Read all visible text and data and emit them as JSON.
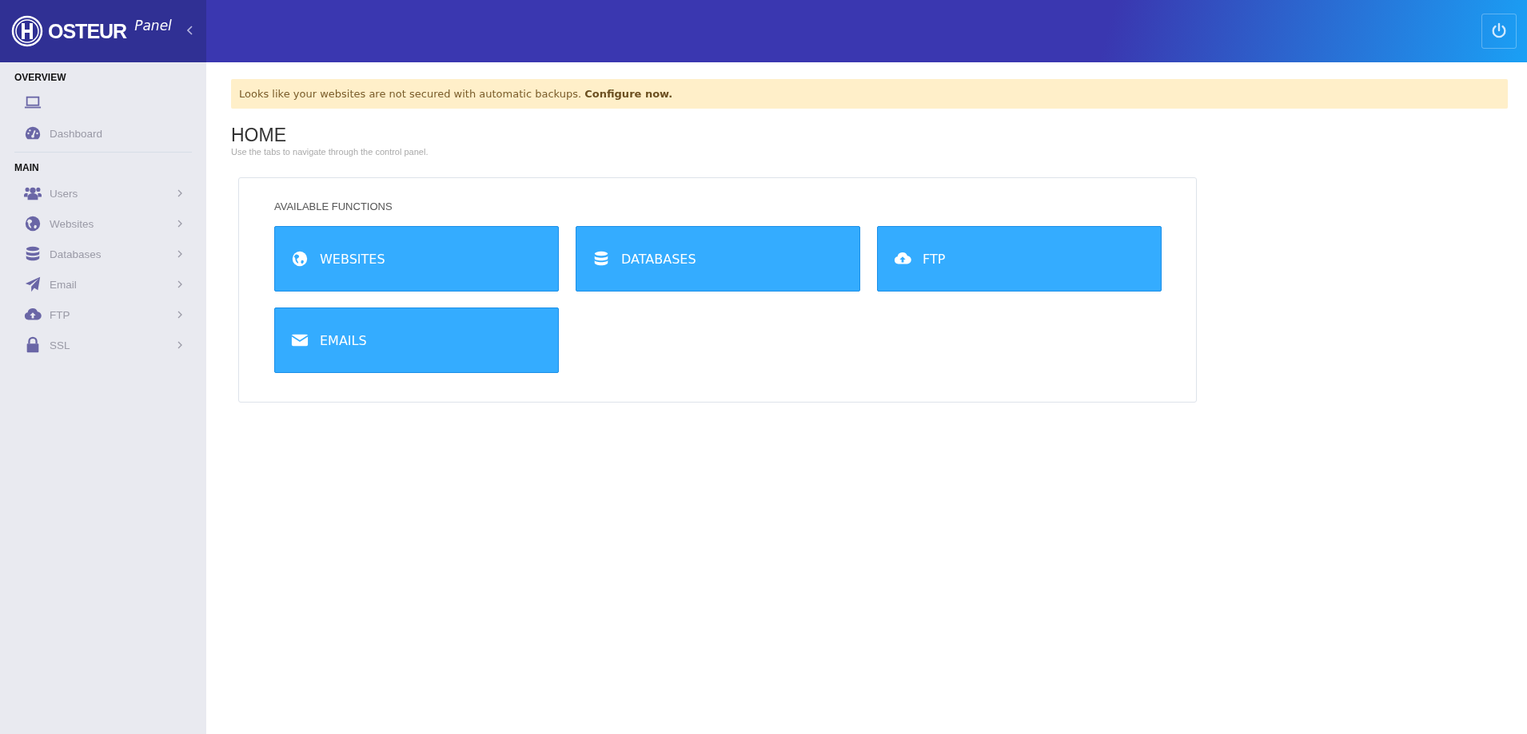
{
  "brand": {
    "logo_text": "OSTEUR",
    "subtitle": "Panel"
  },
  "sidebar": {
    "sections": [
      {
        "title": "OVERVIEW",
        "items": [
          {
            "kind": "laptop",
            "submenu": false
          },
          {
            "kind": "gauge",
            "label": "Dashboard",
            "submenu": false
          }
        ]
      },
      {
        "title": "MAIN",
        "items": [
          {
            "kind": "users",
            "label": "Users",
            "submenu": true
          },
          {
            "kind": "globe",
            "label": "Websites",
            "submenu": true
          },
          {
            "kind": "database",
            "label": "Databases",
            "submenu": true
          },
          {
            "kind": "plane",
            "label": "Email",
            "submenu": true
          },
          {
            "kind": "cloud",
            "label": "FTP",
            "submenu": true
          },
          {
            "kind": "lock",
            "label": "SSL",
            "submenu": true
          }
        ]
      }
    ]
  },
  "alert": {
    "text": "Looks like your websites are not secured with automatic backups. ",
    "link": "Configure now."
  },
  "page": {
    "title": "HOME",
    "subtitle": "Use the tabs to navigate through the control panel."
  },
  "functions": {
    "title": "AVAILABLE FUNCTIONS",
    "buttons": [
      {
        "kind": "globe",
        "label": "WEBSITES"
      },
      {
        "kind": "database",
        "label": "DATABASES"
      },
      {
        "kind": "cloud",
        "label": "FTP"
      },
      {
        "kind": "envelope",
        "label": "EMAILS"
      }
    ]
  }
}
